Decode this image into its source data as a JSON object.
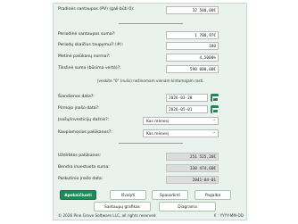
{
  "fields": {
    "initial_savings": {
      "label": "Pradinės santaupos (PV) (gali būti 0):",
      "value": "32 500,00€"
    },
    "periodic_savings": {
      "label": "Periodinė santaupos suma?:",
      "value": "1 700,97€"
    },
    "num_periods": {
      "label": "Periodų skaičius taupymui? (#):",
      "value": "180"
    },
    "annual_rate": {
      "label": "Metinė palūkanų norma?:",
      "value": "4,5000%"
    },
    "future_value": {
      "label": "Tikslinė suma (būsima vertė)?:",
      "value": "590 000,00€"
    }
  },
  "hint": "Įveskite \"0\" (nulis) nežinomam vienam kintamajam rasti.",
  "dates": {
    "today": {
      "label": "Šiandienos data?:",
      "value": "2026-03-28"
    },
    "first_deposit": {
      "label": "Pirmojo įnašo data?:",
      "value": "2026-05-01"
    }
  },
  "selects": {
    "deposit_frequency": {
      "label": "Įnašų/investicijų dažnis?:",
      "value": "Kas mėnesį"
    },
    "compounding": {
      "label": "Kaupiamosios palūkanos?:",
      "value": "Kas mėnesį"
    }
  },
  "results": {
    "interest_earned": {
      "label": "Uždirbtos palūkanos:",
      "value": "251 525,26€"
    },
    "total_invested": {
      "label": "Bendra investuota suma:",
      "value": "338 474,60€"
    },
    "last_deposit_date": {
      "label": "Paskutinio įnašo data:",
      "value": "2041-04-01"
    }
  },
  "buttons": {
    "calculate": "Apskaičiuoti",
    "clear": "Išvalyti",
    "print": "Spausdinti",
    "help": "Pagalba",
    "schedule": "Santaupų grafikas",
    "chart": "Diagrama"
  },
  "footer": {
    "copyright": "© 2026 Pine Grove Software LLC, all rights reserved",
    "format": "€ : YYYY-MM-DD"
  },
  "colors": {
    "accent": "#1e8a5a",
    "panel": "#e9f2ed"
  }
}
